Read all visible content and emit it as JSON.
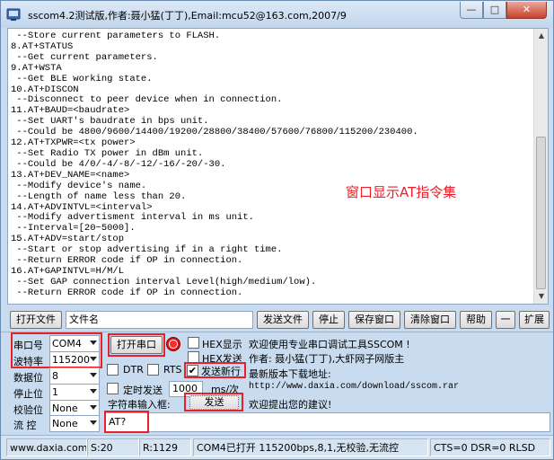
{
  "window": {
    "title": "sscom4.2测试版,作者:聂小猛(丁丁),Email:mcu52@163.com,2007/9",
    "min_glyph": "—",
    "max_glyph": "□",
    "close_glyph": "✕"
  },
  "terminal": {
    "lines": [
      " --Store current parameters to FLASH.",
      "8.AT+STATUS",
      " --Get current parameters.",
      "9.AT+WSTA",
      " --Get BLE working state.",
      "10.AT+DISCON",
      " --Disconnect to peer device when in connection.",
      "11.AT+BAUD=<baudrate>",
      " --Set UART's baudrate in bps unit.",
      " --Could be 4800/9600/14400/19200/28800/38400/57600/76800/115200/230400.",
      "12.AT+TXPWR=<tx power>",
      " --Set Radio TX power in dBm unit.",
      " --Could be 4/0/-4/-8/-12/-16/-20/-30.",
      "13.AT+DEV_NAME=<name>",
      " --Modify device's name.",
      " --Length of name less than 20.",
      "14.AT+ADVINTVL=<interval>",
      " --Modify advertisment interval in ms unit.",
      " --Interval=[20~5000].",
      "15.AT+ADV=start/stop",
      " --Start or stop advertising if in a right time.",
      " --Return ERROR code if OP in connection.",
      "16.AT+GAPINTVL=H/M/L",
      " --Set GAP connection interval Level(high/medium/low).",
      " --Return ERROR code if OP in connection."
    ],
    "annotation": "窗口显示AT指令集"
  },
  "toolbar": {
    "open_file": "打开文件",
    "file_name_value": "文件名",
    "send_file": "发送文件",
    "stop": "停止",
    "save_window": "保存窗口",
    "clear_window": "清除窗口",
    "help": "帮助",
    "dash": "一",
    "expand": "扩展"
  },
  "serial": {
    "port_label": "串口号",
    "port_value": "COM4",
    "baud_label": "波特率",
    "baud_value": "115200",
    "databits_label": "数据位",
    "databits_value": "8",
    "stopbits_label": "停止位",
    "stopbits_value": "1",
    "parity_label": "校验位",
    "parity_value": "None",
    "flow_label": "流 控",
    "flow_value": "None",
    "open_port": "打开串口"
  },
  "options": {
    "hex_display": "HEX显示",
    "hex_send": "HEX发送",
    "dtr": "DTR",
    "rts": "RTS",
    "send_newline": "发送新行",
    "send_newline_checked": "✔",
    "timed_send": "定时发送",
    "interval_value": "1000",
    "interval_unit": "ms/次",
    "string_input_label": "字符串输入框:",
    "send_button": "发送",
    "command_value": "AT?"
  },
  "info": {
    "welcome": "欢迎使用专业串口调试工具SSCOM !",
    "author": "作者: 聂小猛(丁丁),大虾网子网版主",
    "latest": "最新版本下载地址:",
    "url": "http://www.daxia.com/download/sscom.rar",
    "feedback": "欢迎提出您的建议!"
  },
  "status": {
    "site": "www.daxia.com",
    "sent": "S:20",
    "received": "R:1129",
    "port_state": "COM4已打开  115200bps,8,1,无校验,无流控",
    "lines": "CTS=0 DSR=0 RLSD"
  },
  "colors": {
    "highlight": "#e8202a",
    "frame": "#c9dcef"
  }
}
